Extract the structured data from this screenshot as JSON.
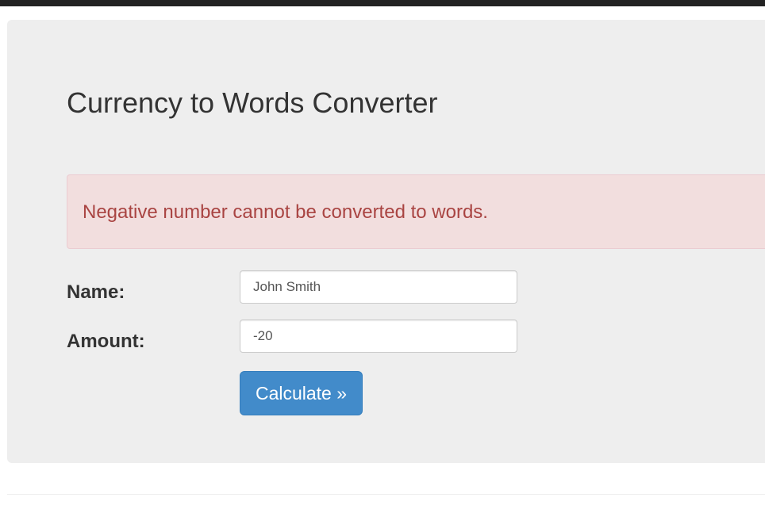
{
  "app": {
    "title": "Currency to Words Converter"
  },
  "alert": {
    "message": "Negative number cannot be converted to words.",
    "type": "danger",
    "color": "#a94442",
    "background": "#f2dede"
  },
  "form": {
    "name_label": "Name:",
    "name_value": "John Smith",
    "amount_label": "Amount:",
    "amount_value": "-20",
    "submit_label": "Calculate »"
  },
  "colors": {
    "primary": "#428bca",
    "jumbotron": "#eeeeee",
    "topbar": "#222222"
  }
}
